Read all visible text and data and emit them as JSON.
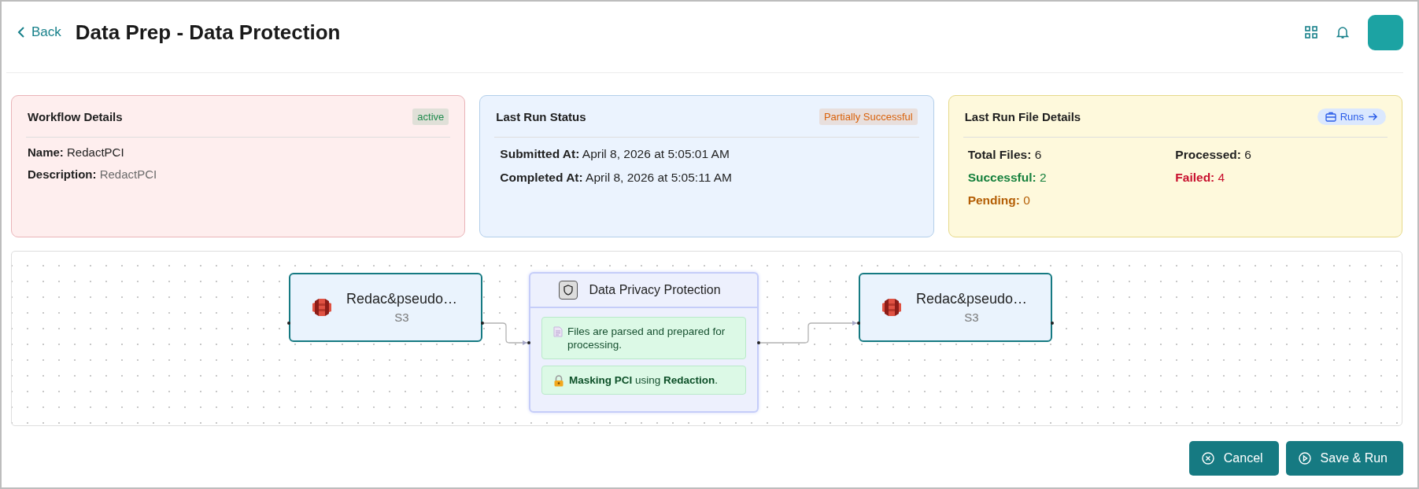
{
  "header": {
    "back": "Back",
    "title": "Data Prep - Data Protection"
  },
  "cards": [
    {
      "kind": "workflow",
      "title": "Workflow Details",
      "badge": {
        "text": "active",
        "color": "#1e8a4c"
      },
      "fields": [
        {
          "label": "Name:",
          "value": "RedactPCI",
          "muted": false
        },
        {
          "label": "Description:",
          "value": "RedactPCI",
          "muted": true
        }
      ]
    },
    {
      "kind": "status",
      "title": "Last Run Status",
      "badge": {
        "text": "Partially Successful",
        "color": "#d9620b"
      },
      "fields": [
        {
          "label": "Submitted At:",
          "value": "April 8, 2026 at 5:05:01 AM",
          "muted": false
        },
        {
          "label": "Completed At:",
          "value": "April 8, 2026 at 5:05:11 AM",
          "muted": false
        }
      ]
    },
    {
      "kind": "files",
      "title": "Last Run File Details",
      "link": "Runs",
      "stats": [
        {
          "label": "Total Files:",
          "value": "6",
          "color": "#1f1f1f"
        },
        {
          "label": "Processed:",
          "value": "6",
          "color": "#1f1f1f"
        },
        {
          "label": "Successful:",
          "value": "2",
          "color": "#15803d"
        },
        {
          "label": "Failed:",
          "value": "4",
          "color": "#c8102e"
        },
        {
          "label": "Pending:",
          "value": "0",
          "color": "#b45f06"
        }
      ]
    }
  ],
  "flow": {
    "nodes": [
      {
        "kind": "bucket",
        "title": "Redac&pseudo…",
        "subtitle": "S3"
      },
      {
        "kind": "process",
        "title": "Data Privacy Protection",
        "steps": [
          {
            "kind": "document",
            "text": "Files are parsed and prepared for processing."
          },
          {
            "kind": "lock",
            "text": "**Masking PCI** using **Redaction**."
          }
        ]
      },
      {
        "kind": "bucket",
        "title": "Redac&pseudo…",
        "subtitle": "S3"
      }
    ]
  },
  "buttons": [
    {
      "kind": "cancel",
      "label": "Cancel"
    },
    {
      "kind": "run",
      "label": "Save & Run"
    }
  ]
}
